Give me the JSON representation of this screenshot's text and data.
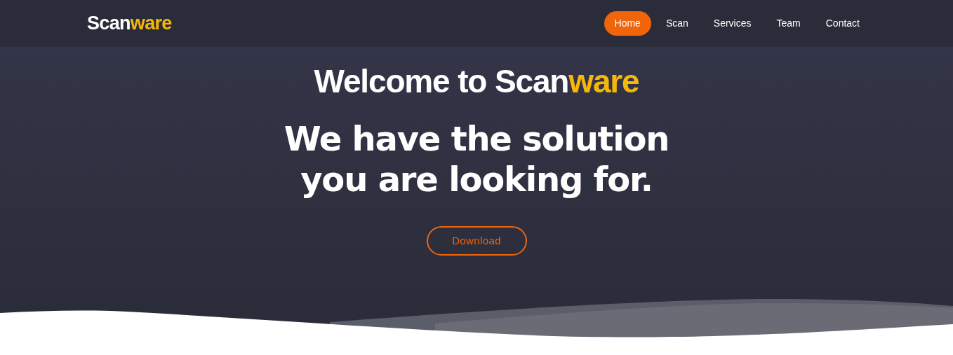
{
  "header": {
    "logo": {
      "text": "Scan",
      "accent": "ware"
    },
    "nav": [
      {
        "label": "Home",
        "selected": true
      },
      {
        "label": "Scan",
        "selected": false
      },
      {
        "label": "Services",
        "selected": false
      },
      {
        "label": "Team",
        "selected": false
      },
      {
        "label": "Contact",
        "selected": false
      }
    ]
  },
  "hero": {
    "title": {
      "text": "Welcome to Scan",
      "accent": "ware"
    },
    "subtitle": "We have the solution you are looking for.",
    "button": "Download"
  }
}
